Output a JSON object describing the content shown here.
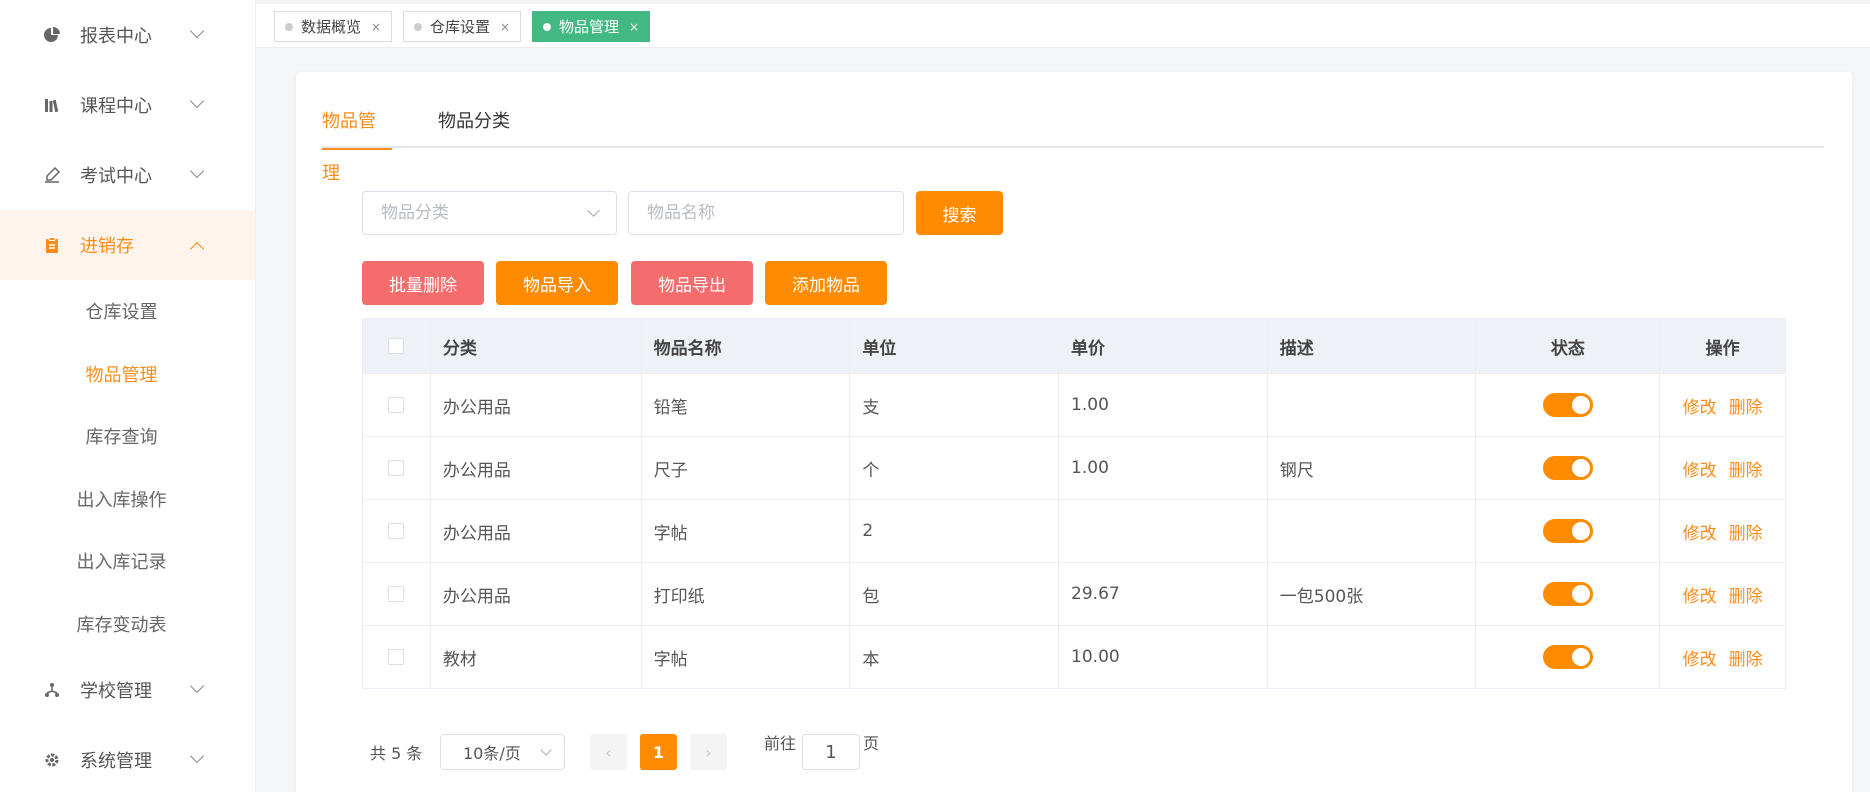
{
  "sidebar": {
    "items": [
      {
        "label": "报表中心",
        "icon": "pie-chart-icon"
      },
      {
        "label": "课程中心",
        "icon": "books-icon"
      },
      {
        "label": "考试中心",
        "icon": "pen-icon"
      },
      {
        "label": "进销存",
        "icon": "clipboard-icon"
      },
      {
        "label": "学校管理",
        "icon": "tree-icon"
      },
      {
        "label": "系统管理",
        "icon": "gear-icon"
      }
    ],
    "sub_items": [
      "仓库设置",
      "物品管理",
      "库存查询",
      "出入库操作",
      "出入库记录",
      "库存变动表"
    ]
  },
  "tags": [
    {
      "label": "数据概览",
      "close": "×"
    },
    {
      "label": "仓库设置",
      "close": "×"
    },
    {
      "label": "物品管理",
      "close": "×"
    }
  ],
  "tabs": [
    "物品管理",
    "物品分类"
  ],
  "filters": {
    "category_placeholder": "物品分类",
    "name_placeholder": "物品名称",
    "search_label": "搜索"
  },
  "actions": {
    "batch_delete": "批量删除",
    "import": "物品导入",
    "export": "物品导出",
    "add": "添加物品"
  },
  "table": {
    "columns": [
      "分类",
      "物品名称",
      "单位",
      "单价",
      "描述",
      "状态",
      "操作"
    ],
    "edit_label": "修改",
    "delete_label": "删除",
    "rows": [
      {
        "category": "办公用品",
        "name": "铅笔",
        "unit": "支",
        "price": "1.00",
        "desc": "",
        "enabled": true
      },
      {
        "category": "办公用品",
        "name": "尺子",
        "unit": "个",
        "price": "1.00",
        "desc": "钢尺",
        "enabled": true
      },
      {
        "category": "办公用品",
        "name": "字帖",
        "unit": "2",
        "price": "",
        "desc": "",
        "enabled": true
      },
      {
        "category": "办公用品",
        "name": "打印纸",
        "unit": "包",
        "price": "29.67",
        "desc": "一包500张",
        "enabled": true
      },
      {
        "category": "教材",
        "name": "字帖",
        "unit": "本",
        "price": "10.00",
        "desc": "",
        "enabled": true
      }
    ]
  },
  "pagination": {
    "total": "共 5 条",
    "page_size": "10条/页",
    "prev": "‹",
    "next": "›",
    "current_page": "1",
    "goto_prefix": "前往",
    "goto_value": "1",
    "goto_suffix": "页"
  },
  "colors": {
    "accent": "#ff8c00",
    "danger": "#f56c6c",
    "tag_active": "#42b983"
  }
}
